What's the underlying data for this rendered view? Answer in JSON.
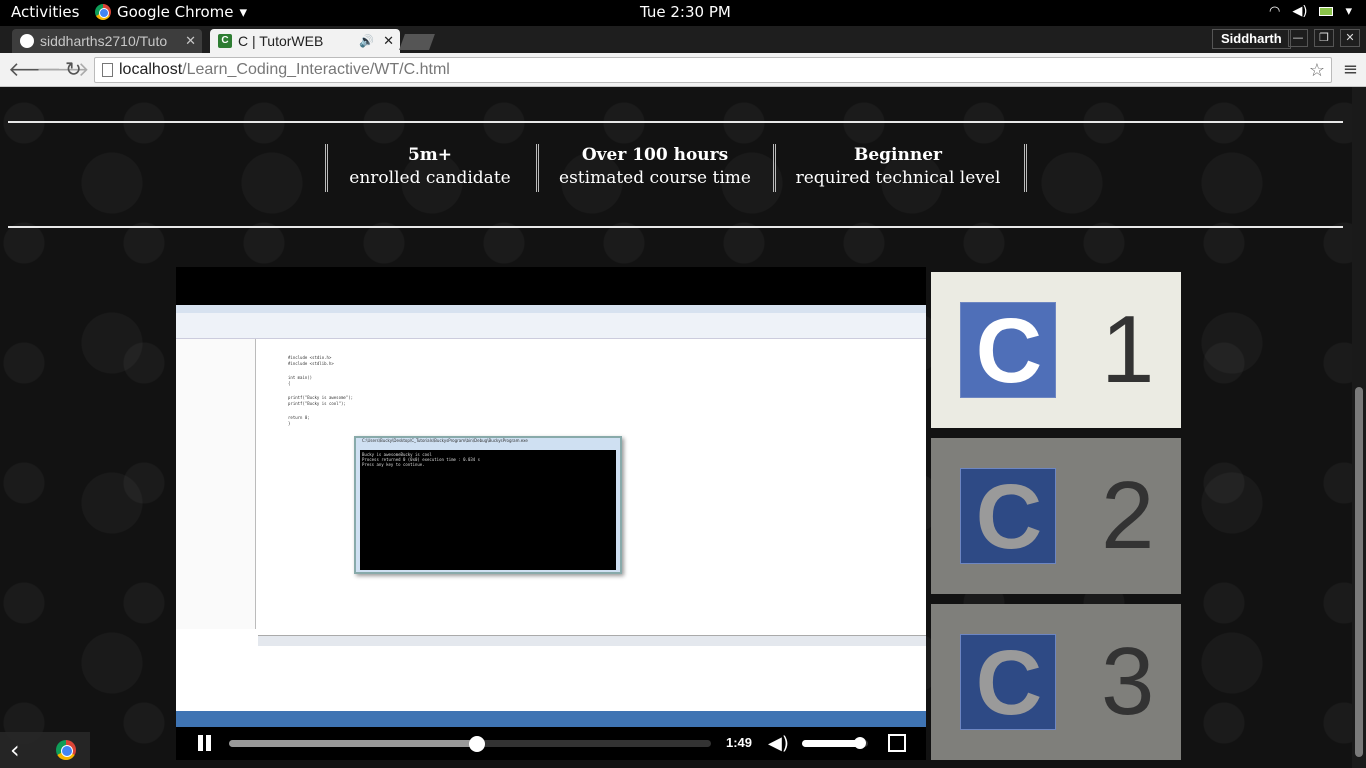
{
  "system_bar": {
    "activities": "Activities",
    "app_name": "Google Chrome",
    "app_menu_arrow": "▾",
    "clock": "Tue  2:30 PM",
    "tray_icons": [
      "wifi-icon",
      "volume-icon",
      "battery-icon"
    ]
  },
  "tabs": [
    {
      "title": "siddharths2710/Tuto",
      "close": "✕",
      "favicon": "github-icon"
    },
    {
      "title": "C | TutorWEB",
      "close": "✕",
      "favicon": "C",
      "audio": "🔊"
    }
  ],
  "window": {
    "profile": "Siddharth",
    "minimize": "—",
    "maximize": "❐",
    "close": "✕"
  },
  "toolbar": {
    "back": "🡐",
    "forward": "🡒",
    "reload": "↻",
    "url_host": "localhost",
    "url_path": "/Learn_Coding_Interactive/WT/C.html",
    "star": "☆",
    "menu": "≡"
  },
  "stats": [
    {
      "value": "5m+",
      "label": "enrolled candidate"
    },
    {
      "value": "Over 100 hours",
      "label": "estimated course time"
    },
    {
      "value": "Beginner",
      "label": "required technical level"
    }
  ],
  "video": {
    "current_time": "1:49",
    "progress_fraction": 0.515,
    "volume_fraction": 0.88,
    "console_title": "C:\\Users\\Bucky\\Desktop\\C_Tutorials\\BuckysProgram\\bin\\Debug\\BuckysProgram.exe",
    "console_lines": [
      "Bucky is awesomeBucky is cool",
      "Process returned 0 (0x0)   execution time : 0.034 s",
      "Press any key to continue."
    ],
    "code_lines": [
      "#include <stdio.h>",
      "#include <stdlib.h>",
      "",
      "int main()",
      "{",
      "",
      "    printf(\"Bucky is awesome\");",
      "    printf(\"Bucky is cool\");",
      "",
      "    return 0;",
      "}"
    ]
  },
  "playlist": [
    {
      "letter": "C",
      "number": "1",
      "bg": "#ebebe3",
      "logo_color": "#4f6fb8"
    },
    {
      "letter": "C",
      "number": "2",
      "bg": "#7f7f7b",
      "logo_color": "#2e4a85"
    },
    {
      "letter": "C",
      "number": "3",
      "bg": "#7f7f7b",
      "logo_color": "#2e4a85"
    }
  ],
  "shelf": {
    "back": "‹"
  }
}
